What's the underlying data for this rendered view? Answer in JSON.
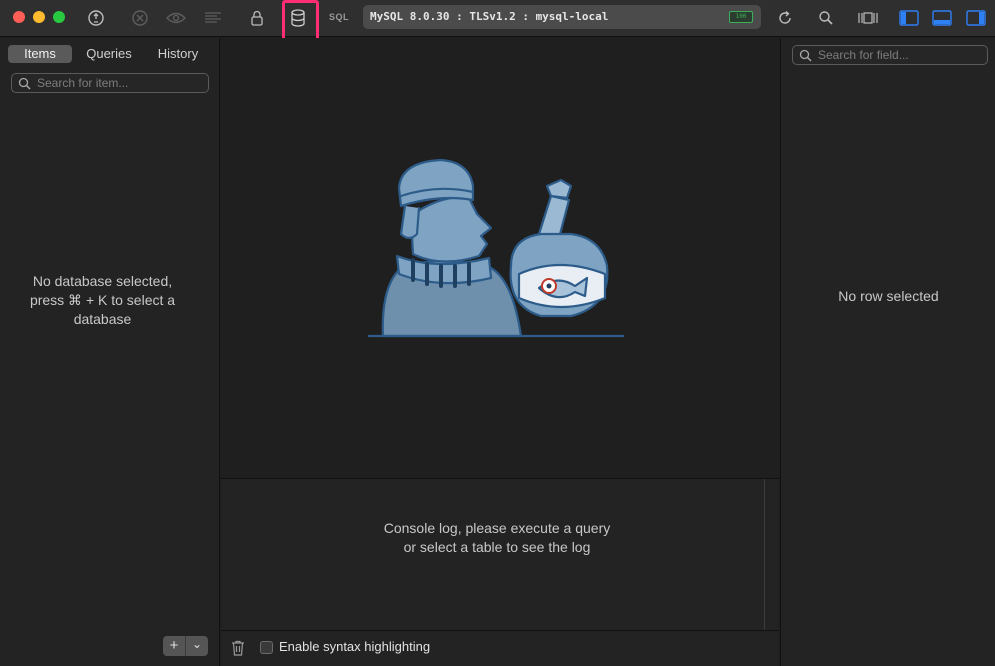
{
  "toolbar": {
    "sql_label": "SQL",
    "connection_text": "MySQL 8.0.30 : TLSv1.2 : mysql-local",
    "connection_badge": "100",
    "colors": {
      "close": "#ff5f57",
      "minimize": "#febc2e",
      "maximize": "#28c840",
      "highlight": "#ff2e73"
    }
  },
  "sidebar": {
    "tabs": [
      "Items",
      "Queries",
      "History"
    ],
    "search_placeholder": "Search for item...",
    "empty_message": [
      "No database selected,",
      "press ⌘ + K to select a",
      "database"
    ],
    "add_label": "+",
    "more_label": "⌄"
  },
  "console": {
    "message": [
      "Console log, please execute a query",
      "or select a table to see the log"
    ],
    "syntax_label": "Enable syntax highlighting"
  },
  "detail": {
    "search_placeholder": "Search for field...",
    "empty_message": "No row selected"
  }
}
